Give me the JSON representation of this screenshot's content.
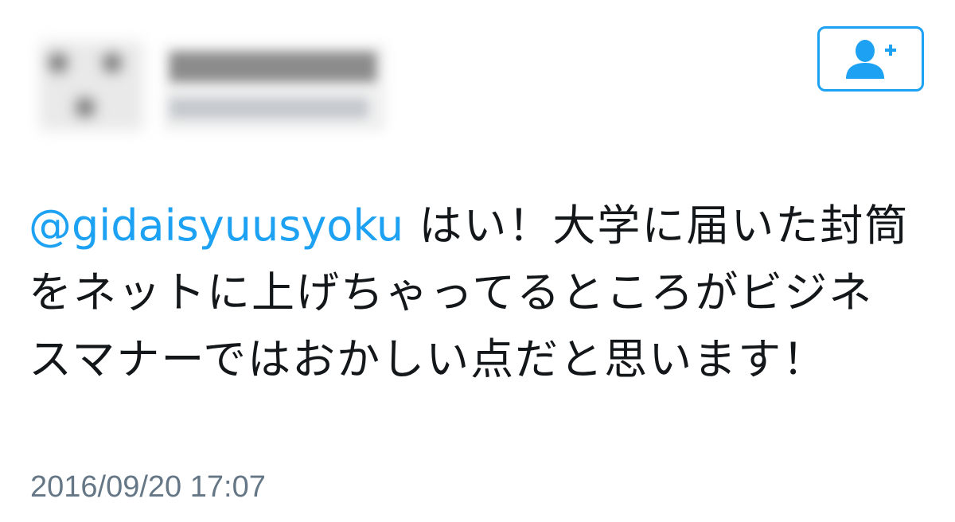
{
  "tweet": {
    "mention": "@gidaisyuusyoku",
    "body": " はい！大学に届いた封筒をネットに上げちゃってるところがビジネスマナーではおかしい点だと思います！",
    "timestamp": "2016/09/20 17:07"
  },
  "follow_button": {
    "icon": "add-user-icon"
  },
  "colors": {
    "accent": "#1da1f2",
    "text": "#14171a",
    "meta": "#657786"
  }
}
